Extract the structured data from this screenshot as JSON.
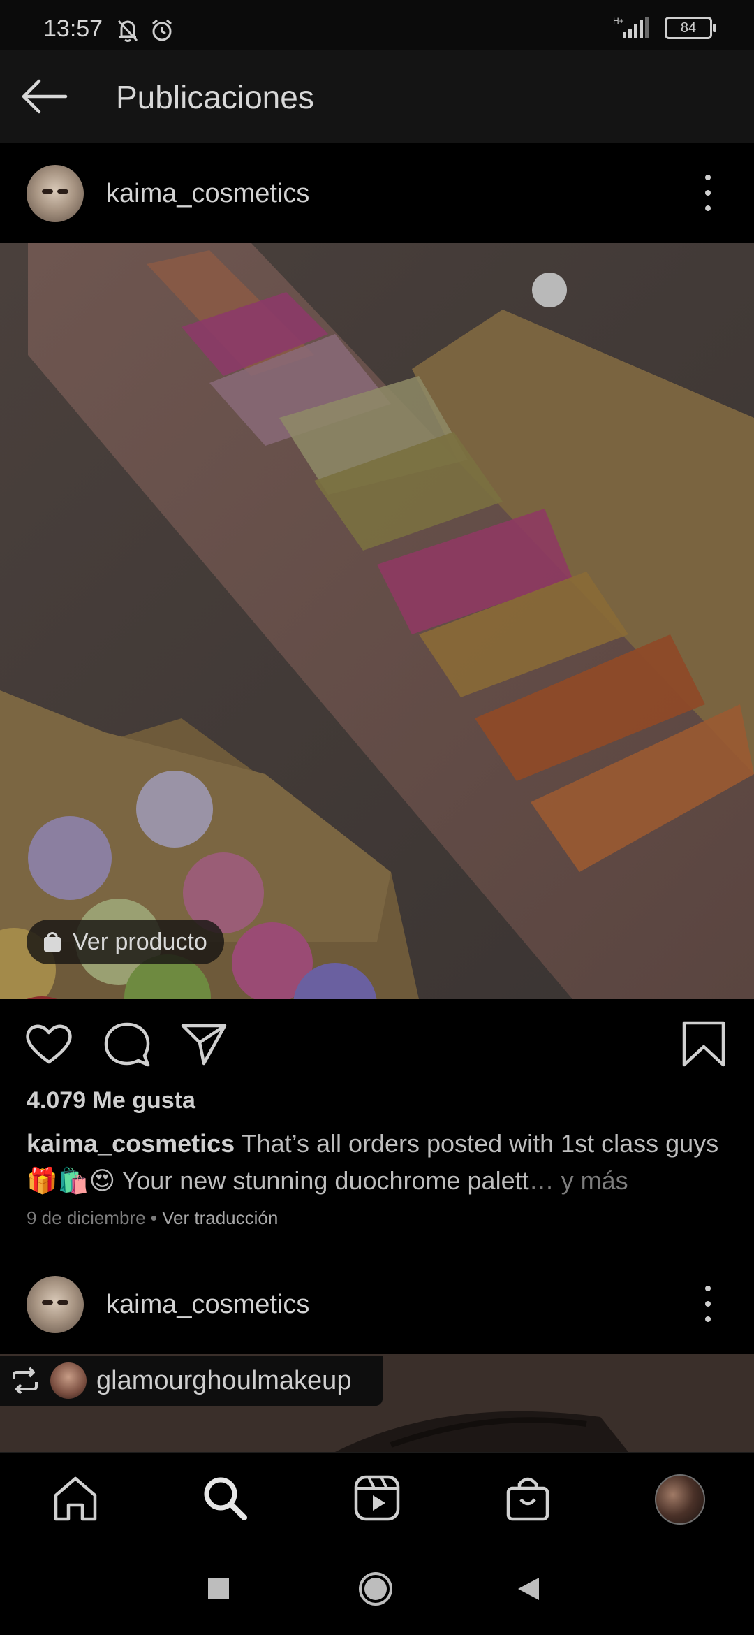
{
  "status_bar": {
    "time": "13:57",
    "battery": "84",
    "network": "H+"
  },
  "app_bar": {
    "title": "Publicaciones"
  },
  "post1": {
    "username": "kaima_cosmetics",
    "product_button": "Ver producto",
    "likes": "4.079 Me gusta",
    "caption_user": "kaima_cosmetics",
    "caption_text": " That’s all orders posted with 1st class guys 🎁🛍️😍 Your new stunning duochrome palett",
    "caption_more": "… y más",
    "date": "9 de diciembre",
    "separator": " • ",
    "translate": "Ver traducción"
  },
  "post2": {
    "username": "kaima_cosmetics",
    "repost_user": "glamourghoulmakeup"
  },
  "icons": {
    "back": "arrow-left-icon",
    "like": "heart-icon",
    "comment": "comment-icon",
    "share": "send-icon",
    "save": "bookmark-icon",
    "home": "home-icon",
    "search": "search-icon",
    "reels": "reels-icon",
    "shop": "shop-icon"
  },
  "colors": {
    "background": "#000000",
    "app_bar": "#141414",
    "text_primary": "#d3d3d3",
    "text_secondary": "#7c7c7c"
  }
}
